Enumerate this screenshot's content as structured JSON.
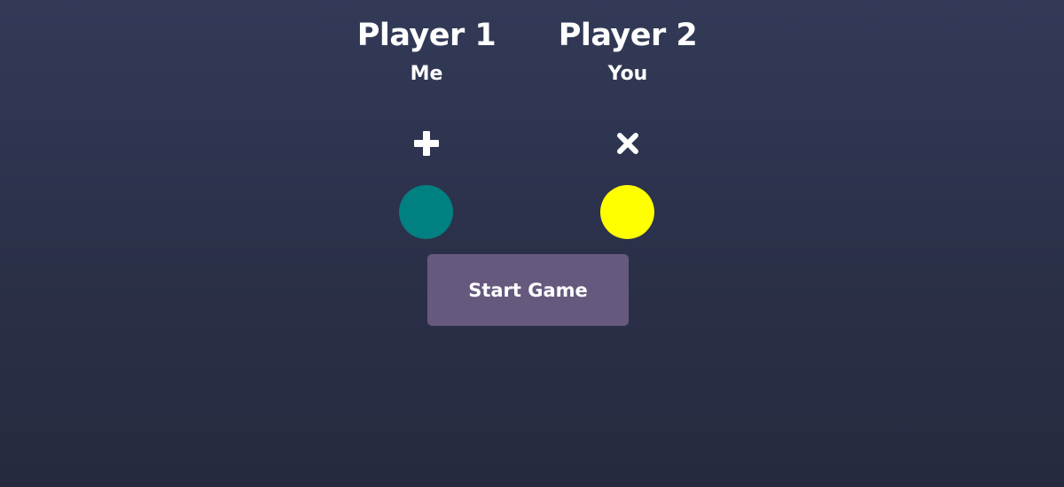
{
  "players": [
    {
      "title": "Player 1",
      "name": "Me",
      "marker_icon": "plus-icon",
      "color": "#008080"
    },
    {
      "title": "Player 2",
      "name": "You",
      "marker_icon": "times-icon",
      "color": "#ffff00"
    }
  ],
  "start_button": {
    "label": "Start Game"
  },
  "colors": {
    "background_top": "#323a57",
    "background_bottom": "#252a3e",
    "button": "#655a7d",
    "text": "#ffffff"
  }
}
